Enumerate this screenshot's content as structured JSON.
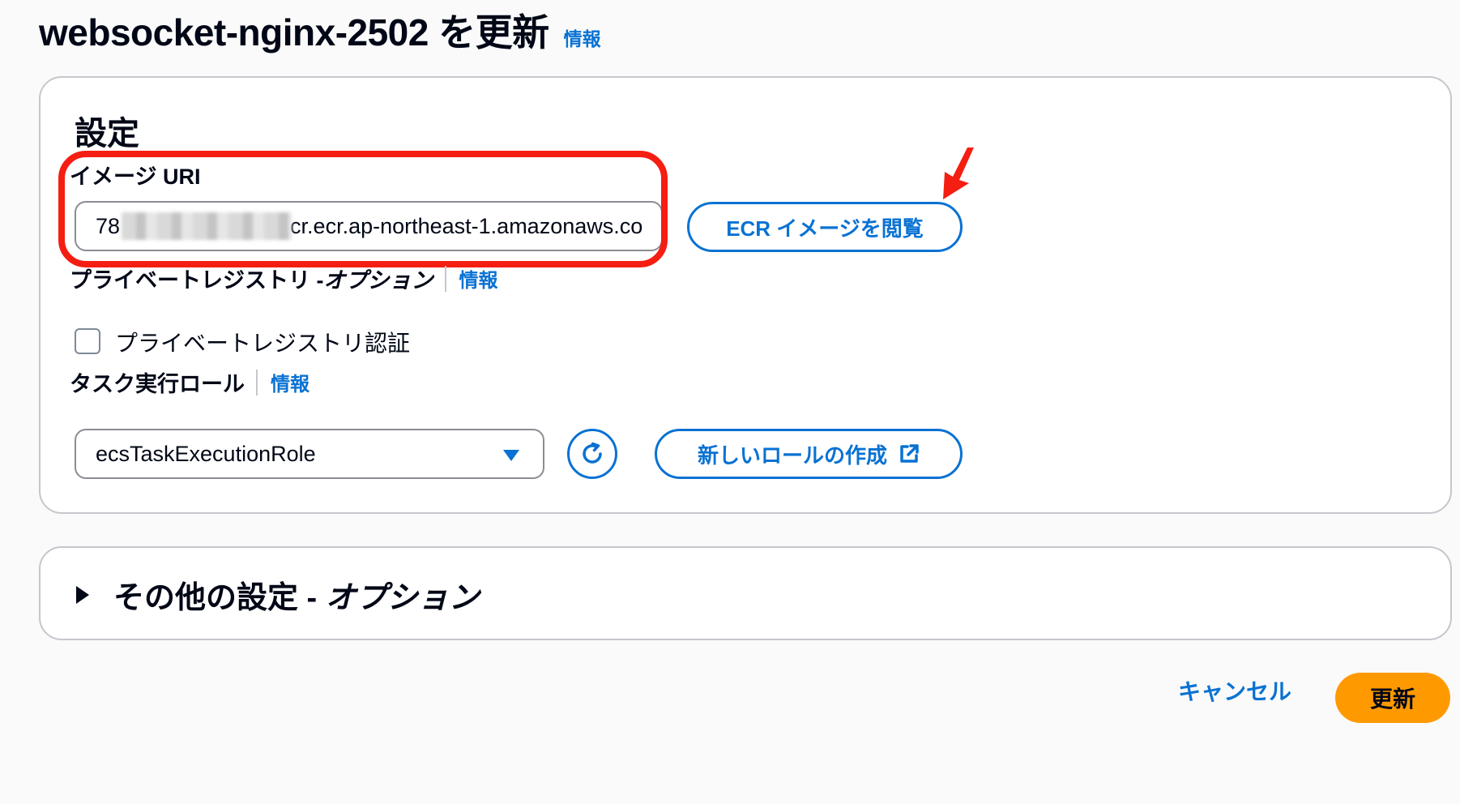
{
  "header": {
    "title": "websocket-nginx-2502 を更新",
    "info_link": "情報"
  },
  "settings": {
    "section_title": "設定",
    "image_uri": {
      "label": "イメージ URI",
      "value_prefix": "78",
      "value_suffix": "cr.ecr.ap-northeast-1.amazonaws.co",
      "browse_button": "ECR イメージを閲覧"
    },
    "private_registry": {
      "label": "プライベートレジストリ - ",
      "label_optional": "オプション",
      "info_link": "情報",
      "checkbox_label": "プライベートレジストリ認証",
      "checked": false
    },
    "task_role": {
      "label": "タスク実行ロール",
      "info_link": "情報",
      "selected": "ecsTaskExecutionRole",
      "refresh_icon": "refresh-icon",
      "create_button": "新しいロールの作成",
      "create_button_icon": "external-link-icon"
    }
  },
  "other_settings": {
    "title": "その他の設定 - ",
    "title_optional": "オプション",
    "expanded": false
  },
  "actions": {
    "cancel": "キャンセル",
    "submit": "更新"
  },
  "colors": {
    "link": "#0972d3",
    "primary_button": "#ff9900",
    "annotation": "#f51e12"
  }
}
